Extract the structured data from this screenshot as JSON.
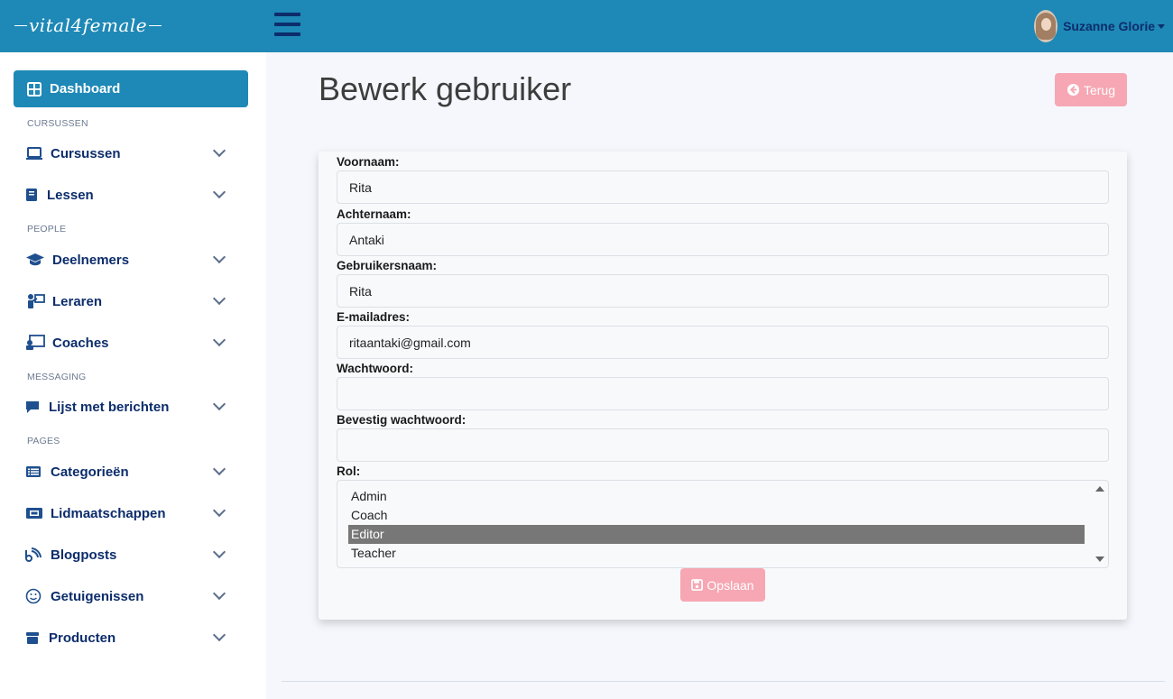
{
  "header": {
    "logo": "vital4female",
    "user_name": "Suzanne Glorie"
  },
  "sidebar": {
    "dashboard": "Dashboard",
    "sections": {
      "cursussen": "CURSUSSEN",
      "people": "PEOPLE",
      "messaging": "MESSAGING",
      "pages": "PAGES"
    },
    "items": [
      {
        "label": "Cursussen",
        "icon": "laptop-icon"
      },
      {
        "label": "Lessen",
        "icon": "book-icon"
      },
      {
        "label": "Deelnemers",
        "icon": "graduation-cap-icon"
      },
      {
        "label": "Leraren",
        "icon": "teacher-icon"
      },
      {
        "label": "Coaches",
        "icon": "chalkboard-user-icon"
      },
      {
        "label": "Lijst met berichten",
        "icon": "message-icon"
      },
      {
        "label": "Categorieën",
        "icon": "list-icon"
      },
      {
        "label": "Lidmaatschappen",
        "icon": "ticket-icon"
      },
      {
        "label": "Blogposts",
        "icon": "blog-icon"
      },
      {
        "label": "Getuigenissen",
        "icon": "smile-icon"
      },
      {
        "label": "Producten",
        "icon": "box-icon"
      }
    ]
  },
  "main": {
    "title": "Bewerk gebruiker",
    "back_button": "Terug",
    "form": {
      "first_name_label": "Voornaam:",
      "first_name_value": "Rita",
      "last_name_label": "Achternaam:",
      "last_name_value": "Antaki",
      "username_label": "Gebruikersnaam:",
      "username_value": "Rita",
      "email_label": "E-mailadres:",
      "email_value": "ritaantaki@gmail.com",
      "password_label": "Wachtwoord:",
      "password_value": "",
      "confirm_label": "Bevestig wachtwoord:",
      "confirm_value": "",
      "role_label": "Rol:",
      "roles": [
        "Admin",
        "Coach",
        "Editor",
        "Teacher"
      ],
      "selected_role": "Editor",
      "save_button": "Opslaan"
    }
  },
  "colors": {
    "primary": "#1e88b6",
    "navy": "#0c2d6b",
    "pink_button": "#f6a7b3",
    "background": "#f5f7fc"
  }
}
